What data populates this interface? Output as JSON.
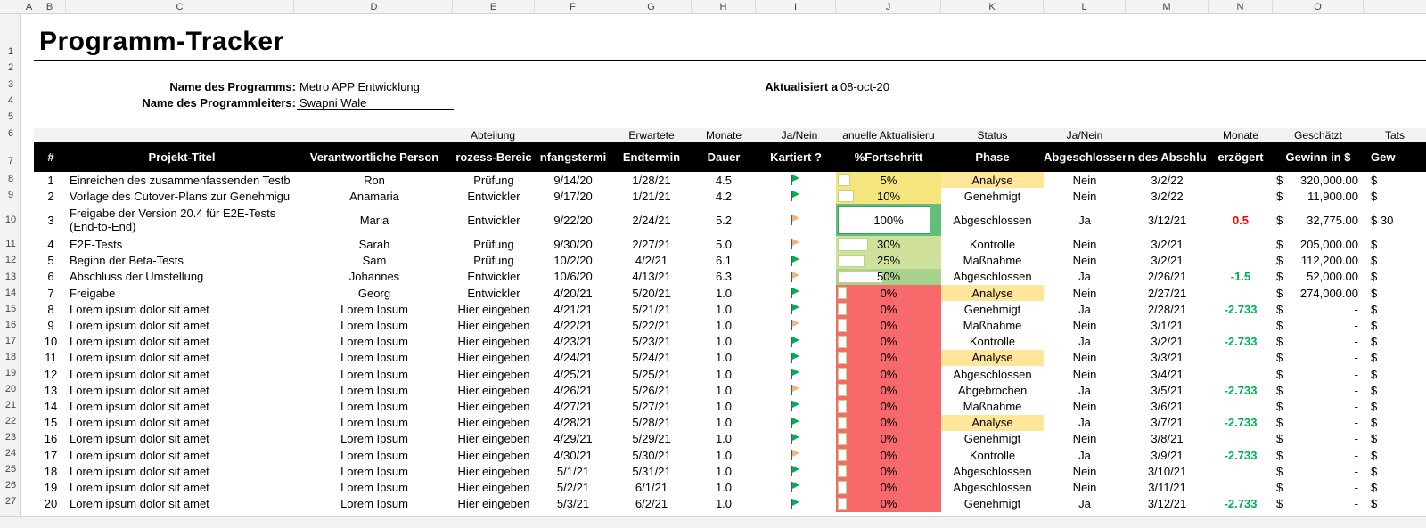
{
  "sheet": {
    "title": "Programm-Tracker",
    "column_letters": [
      "A",
      "B",
      "C",
      "D",
      "E",
      "F",
      "G",
      "H",
      "I",
      "J",
      "K",
      "L",
      "M",
      "N",
      "O"
    ],
    "row_numbers": [
      "1",
      "2",
      "3",
      "4",
      "5",
      "6",
      "7",
      "8",
      "9",
      "10",
      "11",
      "12",
      "13",
      "14",
      "15",
      "16",
      "17",
      "18",
      "19",
      "20",
      "21",
      "22",
      "23",
      "24",
      "25",
      "26",
      "27"
    ]
  },
  "meta": {
    "program_name_label": "Name des Programms:",
    "program_name_value": "Metro APP Entwicklung",
    "manager_label": "Name des Programmleiters:",
    "manager_value": "Swapni Wale",
    "updated_label": "Aktualisiert a",
    "updated_value": "08-oct-20"
  },
  "group_headers": {
    "abteilung": "Abteilung",
    "erwartete": "Erwartete",
    "monate": "Monate",
    "janein1": "Ja/Nein",
    "manuelle": "anuelle Aktualisieru",
    "status": "Status",
    "janein2": "Ja/Nein",
    "monate2": "Monate",
    "geschaetzt": "Geschätzt",
    "tats": "Tats"
  },
  "headers": {
    "num": "#",
    "titel": "Projekt-Titel",
    "person": "Verantwortliche Person",
    "bereich": "rozess-Bereic",
    "anfang": "nfangstermi",
    "end": "Endtermin",
    "dauer": "Dauer",
    "kartiert": "Kartiert ?",
    "fortschritt": "%Fortschritt",
    "phase": "Phase",
    "abgeschlossen": "Abgeschlossen",
    "abschluss": "n des Abschlu",
    "verzoegert": "erzögert",
    "gewinn": "Gewinn in $",
    "gew2": "Gew"
  },
  "rows": [
    {
      "num": "1",
      "titel": "Einreichen des zusammenfassenden Testb",
      "person": "Ron",
      "bereich": "Prüfung",
      "anfang": "9/14/20",
      "end": "1/28/21",
      "dauer": "4.5",
      "flag": "green",
      "progress": 0.05,
      "progress_label": "5%",
      "phase": "Analyse",
      "phase_hl": true,
      "abgeschlossen": "Nein",
      "abschluss": "3/2/22",
      "verzoegert": "",
      "delay_type": "",
      "dollar": "$",
      "gewinn": "320,000.00",
      "gew2": "$"
    },
    {
      "num": "2",
      "titel": "Vorlage des Cutover-Plans zur Genehmigu",
      "person": "Anamaria",
      "bereich": "Entwickler",
      "anfang": "9/17/20",
      "end": "1/21/21",
      "dauer": "4.2",
      "flag": "green",
      "progress": 0.1,
      "progress_label": "10%",
      "phase": "Genehmigt",
      "phase_hl": false,
      "abgeschlossen": "Nein",
      "abschluss": "3/2/22",
      "verzoegert": "",
      "delay_type": "",
      "dollar": "$",
      "gewinn": "11,900.00",
      "gew2": "$"
    },
    {
      "num": "3",
      "titel": "Freigabe der Version 20.4 für E2E-Tests (End-to-End)",
      "person": "Maria",
      "bereich": "Entwickler",
      "anfang": "9/22/20",
      "end": "2/24/21",
      "dauer": "5.2",
      "flag": "orange",
      "progress": 1.0,
      "progress_label": "100%",
      "phase": "Abgeschlossen",
      "phase_hl": false,
      "abgeschlossen": "Ja",
      "abschluss": "3/12/21",
      "verzoegert": "0.5",
      "delay_type": "pos",
      "dollar": "$",
      "gewinn": "32,775.00",
      "gew2": "$ 30"
    },
    {
      "num": "4",
      "titel": "E2E-Tests",
      "person": "Sarah",
      "bereich": "Prüfung",
      "anfang": "9/30/20",
      "end": "2/27/21",
      "dauer": "5.0",
      "flag": "orange",
      "progress": 0.3,
      "progress_label": "30%",
      "phase": "Kontrolle",
      "phase_hl": false,
      "abgeschlossen": "Nein",
      "abschluss": "3/2/21",
      "verzoegert": "",
      "delay_type": "",
      "dollar": "$",
      "gewinn": "205,000.00",
      "gew2": "$"
    },
    {
      "num": "5",
      "titel": "Beginn der Beta-Tests",
      "person": "Sam",
      "bereich": "Prüfung",
      "anfang": "10/2/20",
      "end": "4/2/21",
      "dauer": "6.1",
      "flag": "green",
      "progress": 0.25,
      "progress_label": "25%",
      "phase": "Maßnahme",
      "phase_hl": false,
      "abgeschlossen": "Nein",
      "abschluss": "3/2/21",
      "verzoegert": "",
      "delay_type": "",
      "dollar": "$",
      "gewinn": "112,200.00",
      "gew2": "$"
    },
    {
      "num": "6",
      "titel": "Abschluss der Umstellung",
      "person": "Johannes",
      "bereich": "Entwickler",
      "anfang": "10/6/20",
      "end": "4/13/21",
      "dauer": "6.3",
      "flag": "orange",
      "progress": 0.5,
      "progress_label": "50%",
      "phase": "Abgeschlossen",
      "phase_hl": false,
      "abgeschlossen": "Ja",
      "abschluss": "2/26/21",
      "verzoegert": "-1.5",
      "delay_type": "neg",
      "dollar": "$",
      "gewinn": "52,000.00",
      "gew2": "$"
    },
    {
      "num": "7",
      "titel": "Freigabe",
      "person": "Georg",
      "bereich": "Entwickler",
      "anfang": "4/20/21",
      "end": "5/20/21",
      "dauer": "1.0",
      "flag": "green",
      "progress": 0,
      "progress_label": "0%",
      "phase": "Analyse",
      "phase_hl": true,
      "abgeschlossen": "Nein",
      "abschluss": "2/27/21",
      "verzoegert": "",
      "delay_type": "",
      "dollar": "$",
      "gewinn": "274,000.00",
      "gew2": "$"
    },
    {
      "num": "8",
      "titel": "Lorem ipsum dolor sit amet",
      "person": "Lorem Ipsum",
      "bereich": "Hier eingeben",
      "anfang": "4/21/21",
      "end": "5/21/21",
      "dauer": "1.0",
      "flag": "green",
      "progress": 0,
      "progress_label": "0%",
      "phase": "Genehmigt",
      "phase_hl": false,
      "abgeschlossen": "Ja",
      "abschluss": "2/28/21",
      "verzoegert": "-2.733",
      "delay_type": "neg",
      "dollar": "$",
      "gewinn": "-",
      "gew2": "$"
    },
    {
      "num": "9",
      "titel": "Lorem ipsum dolor sit amet",
      "person": "Lorem Ipsum",
      "bereich": "Hier eingeben",
      "anfang": "4/22/21",
      "end": "5/22/21",
      "dauer": "1.0",
      "flag": "orange",
      "progress": 0,
      "progress_label": "0%",
      "phase": "Maßnahme",
      "phase_hl": false,
      "abgeschlossen": "Nein",
      "abschluss": "3/1/21",
      "verzoegert": "",
      "delay_type": "",
      "dollar": "$",
      "gewinn": "-",
      "gew2": "$"
    },
    {
      "num": "10",
      "titel": "Lorem ipsum dolor sit amet",
      "person": "Lorem Ipsum",
      "bereich": "Hier eingeben",
      "anfang": "4/23/21",
      "end": "5/23/21",
      "dauer": "1.0",
      "flag": "green",
      "progress": 0,
      "progress_label": "0%",
      "phase": "Kontrolle",
      "phase_hl": false,
      "abgeschlossen": "Ja",
      "abschluss": "3/2/21",
      "verzoegert": "-2.733",
      "delay_type": "neg",
      "dollar": "$",
      "gewinn": "-",
      "gew2": "$"
    },
    {
      "num": "11",
      "titel": "Lorem ipsum dolor sit amet",
      "person": "Lorem Ipsum",
      "bereich": "Hier eingeben",
      "anfang": "4/24/21",
      "end": "5/24/21",
      "dauer": "1.0",
      "flag": "green",
      "progress": 0,
      "progress_label": "0%",
      "phase": "Analyse",
      "phase_hl": true,
      "abgeschlossen": "Nein",
      "abschluss": "3/3/21",
      "verzoegert": "",
      "delay_type": "",
      "dollar": "$",
      "gewinn": "-",
      "gew2": "$"
    },
    {
      "num": "12",
      "titel": "Lorem ipsum dolor sit amet",
      "person": "Lorem Ipsum",
      "bereich": "Hier eingeben",
      "anfang": "4/25/21",
      "end": "5/25/21",
      "dauer": "1.0",
      "flag": "green",
      "progress": 0,
      "progress_label": "0%",
      "phase": "Abgeschlossen",
      "phase_hl": false,
      "abgeschlossen": "Nein",
      "abschluss": "3/4/21",
      "verzoegert": "",
      "delay_type": "",
      "dollar": "$",
      "gewinn": "-",
      "gew2": "$"
    },
    {
      "num": "13",
      "titel": "Lorem ipsum dolor sit amet",
      "person": "Lorem Ipsum",
      "bereich": "Hier eingeben",
      "anfang": "4/26/21",
      "end": "5/26/21",
      "dauer": "1.0",
      "flag": "orange",
      "progress": 0,
      "progress_label": "0%",
      "phase": "Abgebrochen",
      "phase_hl": false,
      "abgeschlossen": "Ja",
      "abschluss": "3/5/21",
      "verzoegert": "-2.733",
      "delay_type": "neg",
      "dollar": "$",
      "gewinn": "-",
      "gew2": "$"
    },
    {
      "num": "14",
      "titel": "Lorem ipsum dolor sit amet",
      "person": "Lorem Ipsum",
      "bereich": "Hier eingeben",
      "anfang": "4/27/21",
      "end": "5/27/21",
      "dauer": "1.0",
      "flag": "green",
      "progress": 0,
      "progress_label": "0%",
      "phase": "Maßnahme",
      "phase_hl": false,
      "abgeschlossen": "Nein",
      "abschluss": "3/6/21",
      "verzoegert": "",
      "delay_type": "",
      "dollar": "$",
      "gewinn": "-",
      "gew2": "$"
    },
    {
      "num": "15",
      "titel": "Lorem ipsum dolor sit amet",
      "person": "Lorem Ipsum",
      "bereich": "Hier eingeben",
      "anfang": "4/28/21",
      "end": "5/28/21",
      "dauer": "1.0",
      "flag": "green",
      "progress": 0,
      "progress_label": "0%",
      "phase": "Analyse",
      "phase_hl": true,
      "abgeschlossen": "Ja",
      "abschluss": "3/7/21",
      "verzoegert": "-2.733",
      "delay_type": "neg",
      "dollar": "$",
      "gewinn": "-",
      "gew2": "$"
    },
    {
      "num": "16",
      "titel": "Lorem ipsum dolor sit amet",
      "person": "Lorem Ipsum",
      "bereich": "Hier eingeben",
      "anfang": "4/29/21",
      "end": "5/29/21",
      "dauer": "1.0",
      "flag": "green",
      "progress": 0,
      "progress_label": "0%",
      "phase": "Genehmigt",
      "phase_hl": false,
      "abgeschlossen": "Nein",
      "abschluss": "3/8/21",
      "verzoegert": "",
      "delay_type": "",
      "dollar": "$",
      "gewinn": "-",
      "gew2": "$"
    },
    {
      "num": "17",
      "titel": "Lorem ipsum dolor sit amet",
      "person": "Lorem Ipsum",
      "bereich": "Hier eingeben",
      "anfang": "4/30/21",
      "end": "5/30/21",
      "dauer": "1.0",
      "flag": "orange",
      "progress": 0,
      "progress_label": "0%",
      "phase": "Kontrolle",
      "phase_hl": false,
      "abgeschlossen": "Ja",
      "abschluss": "3/9/21",
      "verzoegert": "-2.733",
      "delay_type": "neg",
      "dollar": "$",
      "gewinn": "-",
      "gew2": "$"
    },
    {
      "num": "18",
      "titel": "Lorem ipsum dolor sit amet",
      "person": "Lorem Ipsum",
      "bereich": "Hier eingeben",
      "anfang": "5/1/21",
      "end": "5/31/21",
      "dauer": "1.0",
      "flag": "green",
      "progress": 0,
      "progress_label": "0%",
      "phase": "Abgeschlossen",
      "phase_hl": false,
      "abgeschlossen": "Nein",
      "abschluss": "3/10/21",
      "verzoegert": "",
      "delay_type": "",
      "dollar": "$",
      "gewinn": "-",
      "gew2": "$"
    },
    {
      "num": "19",
      "titel": "Lorem ipsum dolor sit amet",
      "person": "Lorem Ipsum",
      "bereich": "Hier eingeben",
      "anfang": "5/2/21",
      "end": "6/1/21",
      "dauer": "1.0",
      "flag": "green",
      "progress": 0,
      "progress_label": "0%",
      "phase": "Abgeschlossen",
      "phase_hl": false,
      "abgeschlossen": "Nein",
      "abschluss": "3/11/21",
      "verzoegert": "",
      "delay_type": "",
      "dollar": "$",
      "gewinn": "-",
      "gew2": "$"
    },
    {
      "num": "20",
      "titel": "Lorem ipsum dolor sit amet",
      "person": "Lorem Ipsum",
      "bereich": "Hier eingeben",
      "anfang": "5/3/21",
      "end": "6/2/21",
      "dauer": "1.0",
      "flag": "green",
      "progress": 0,
      "progress_label": "0%",
      "phase": "Genehmigt",
      "phase_hl": false,
      "abgeschlossen": "Ja",
      "abschluss": "3/12/21",
      "verzoegert": "-2.733",
      "delay_type": "neg",
      "dollar": "$",
      "gewinn": "-",
      "gew2": "$"
    }
  ]
}
